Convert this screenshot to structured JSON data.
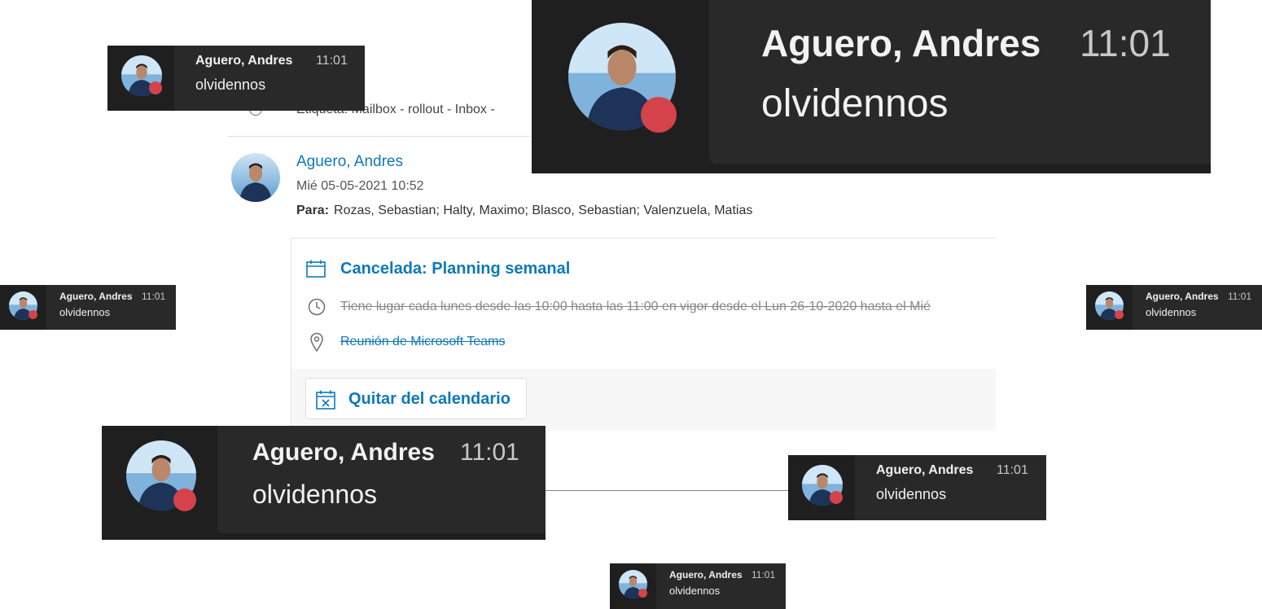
{
  "email": {
    "label_text": "Etiqueta: Mailbox - rollout - Inbox -",
    "sender_name": "Aguero, Andres",
    "sent_date": "Mié 05-05-2021 10:52",
    "to_label": "Para:",
    "recipients": "Rozas, Sebastian; Halty, Maximo; Blasco, Sebastian; Valenzuela, Matias",
    "card": {
      "title": "Cancelada: Planning semanal",
      "recurrence": "Tiene lugar cada lunes desde las 10:00 hasta las 11:00 en vigor desde el Lun 26-10-2020 hasta el Mié",
      "location": "Reunión de Microsoft Teams",
      "remove_button_label": "Quitar del calendario"
    }
  },
  "notification": {
    "sender": "Aguero, Andres",
    "time": "11:01",
    "message": "olvidennos",
    "status_color": "#d64249"
  },
  "colors": {
    "accent": "#0f78b8",
    "toast_bg": "#1f1f1f",
    "toast_panel": "#292929"
  }
}
